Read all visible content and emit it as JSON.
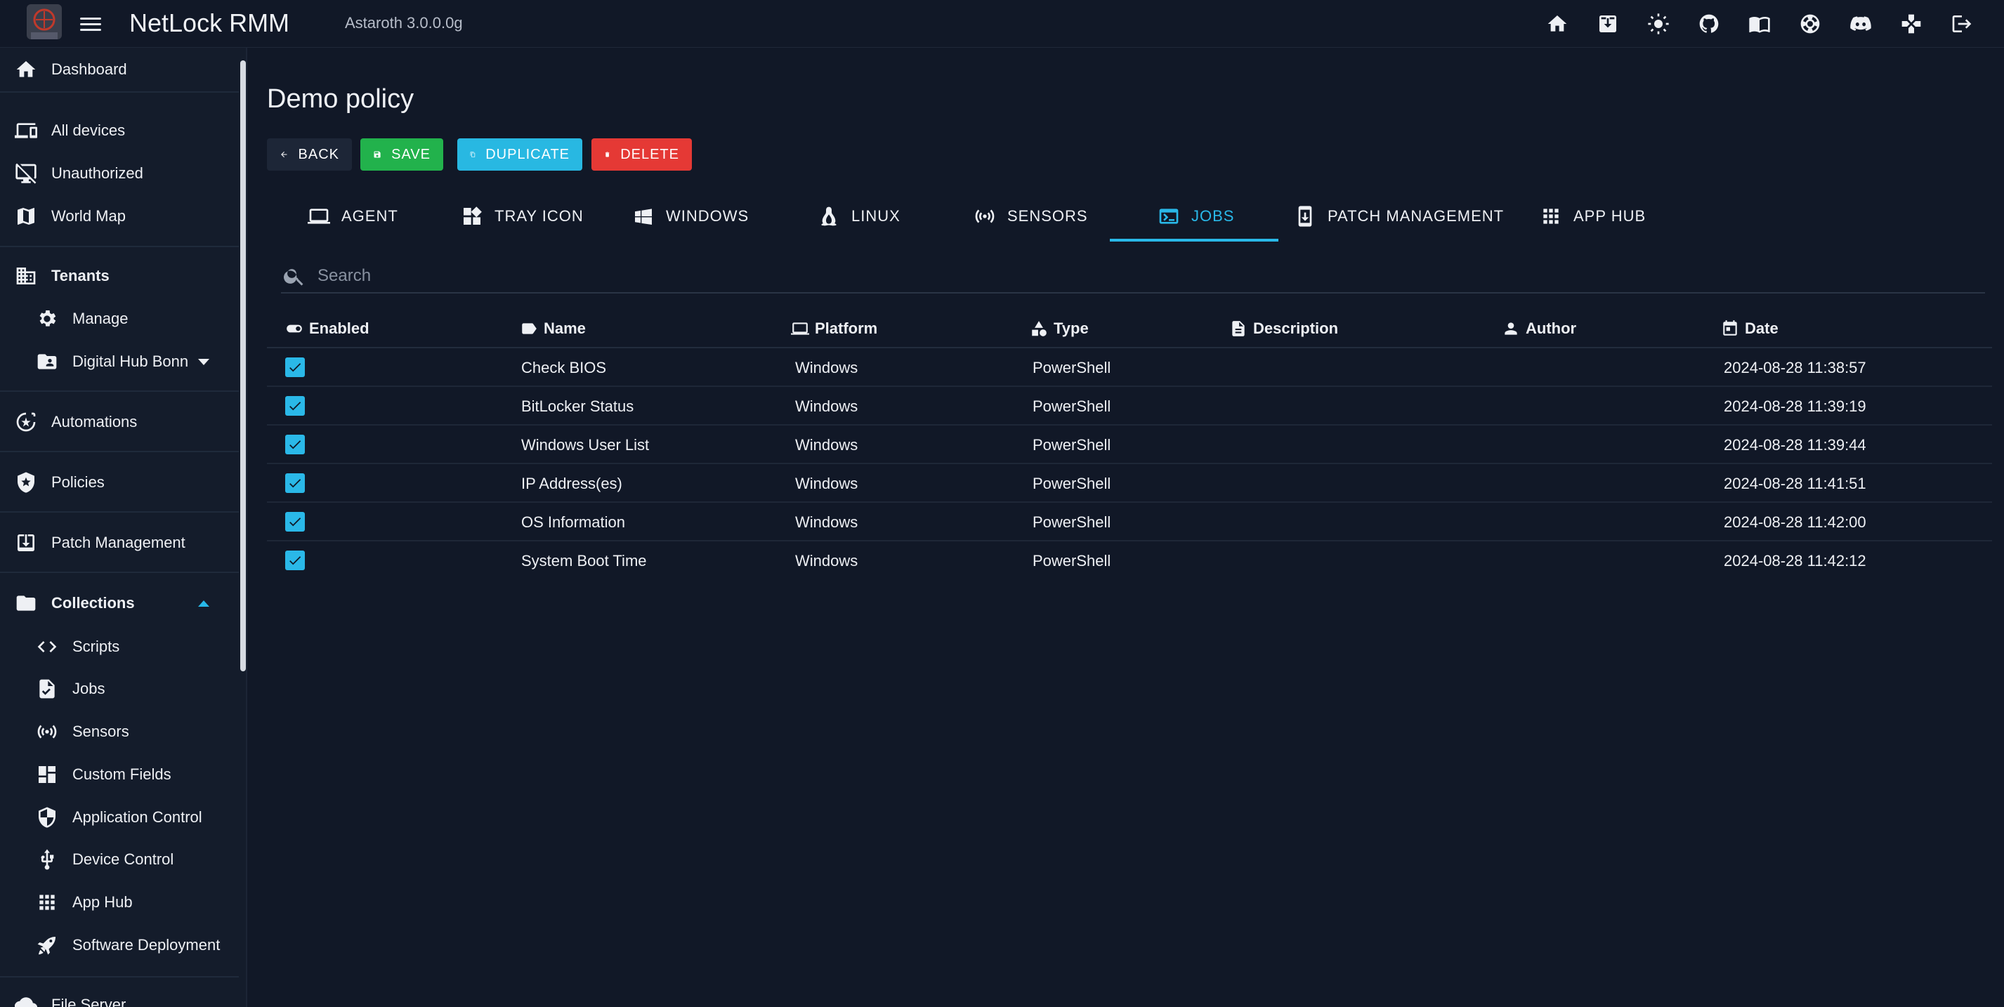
{
  "app": {
    "title": "NetLock RMM",
    "version": "Astaroth 3.0.0.0g"
  },
  "topbar": {
    "icons": [
      "home-icon",
      "download-icon",
      "theme-toggle-icon",
      "github-icon",
      "documentation-icon",
      "support-icon",
      "discord-icon",
      "gamepad-icon",
      "logout-icon"
    ]
  },
  "sidebar": {
    "dashboard": "Dashboard",
    "all_devices": "All devices",
    "unauthorized": "Unauthorized",
    "world_map": "World Map",
    "tenants": "Tenants",
    "manage": "Manage",
    "digital_hub": "Digital Hub Bonn",
    "automations": "Automations",
    "policies": "Policies",
    "patch_management": "Patch Management",
    "collections": "Collections",
    "scripts": "Scripts",
    "jobs": "Jobs",
    "sensors": "Sensors",
    "custom_fields": "Custom Fields",
    "application_control": "Application Control",
    "device_control": "Device Control",
    "app_hub": "App Hub",
    "software_deployment": "Software Deployment",
    "file_server": "File Server"
  },
  "page": {
    "title": "Demo policy",
    "buttons": {
      "back": "BACK",
      "save": "SAVE",
      "duplicate": "DUPLICATE",
      "delete": "DELETE"
    },
    "tabs": [
      "AGENT",
      "TRAY ICON",
      "WINDOWS",
      "LINUX",
      "SENSORS",
      "JOBS",
      "PATCH MANAGEMENT",
      "APP HUB"
    ],
    "active_tab": "JOBS",
    "search_placeholder": "Search"
  },
  "table": {
    "headers": {
      "enabled": "Enabled",
      "name": "Name",
      "platform": "Platform",
      "type": "Type",
      "description": "Description",
      "author": "Author",
      "date": "Date"
    },
    "rows": [
      {
        "enabled": true,
        "name": "Check BIOS",
        "platform": "Windows",
        "type": "PowerShell",
        "description": "",
        "author": "",
        "date": "2024-08-28 11:38:57"
      },
      {
        "enabled": true,
        "name": "BitLocker Status",
        "platform": "Windows",
        "type": "PowerShell",
        "description": "",
        "author": "",
        "date": "2024-08-28 11:39:19"
      },
      {
        "enabled": true,
        "name": "Windows User List",
        "platform": "Windows",
        "type": "PowerShell",
        "description": "",
        "author": "",
        "date": "2024-08-28 11:39:44"
      },
      {
        "enabled": true,
        "name": "IP Address(es)",
        "platform": "Windows",
        "type": "PowerShell",
        "description": "",
        "author": "",
        "date": "2024-08-28 11:41:51"
      },
      {
        "enabled": true,
        "name": "OS Information",
        "platform": "Windows",
        "type": "PowerShell",
        "description": "",
        "author": "",
        "date": "2024-08-28 11:42:00"
      },
      {
        "enabled": true,
        "name": "System Boot Time",
        "platform": "Windows",
        "type": "PowerShell",
        "description": "",
        "author": "",
        "date": "2024-08-28 11:42:12"
      }
    ]
  },
  "colors": {
    "accent": "#29b8e8",
    "save": "#22b24c",
    "delete": "#e53935",
    "background": "#111827"
  }
}
